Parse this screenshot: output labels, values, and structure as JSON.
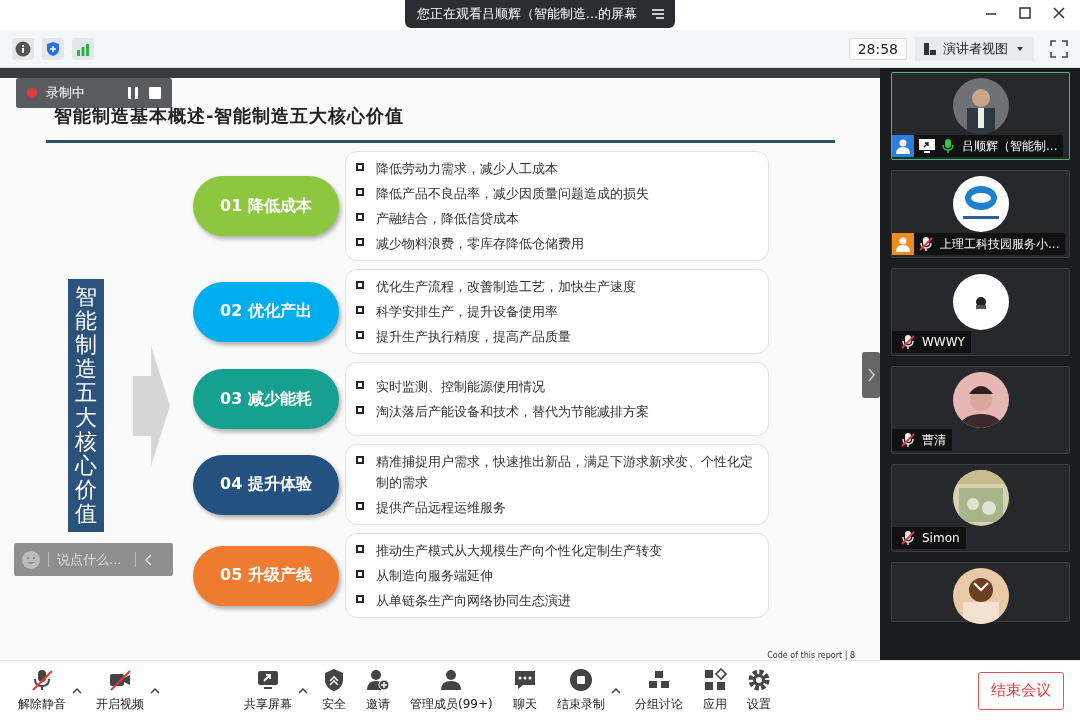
{
  "window": {
    "title": "您正在观看吕顺辉（智能制造...的屏幕"
  },
  "info_bar": {
    "timer": "28:58",
    "view_button": "演讲者视图"
  },
  "recording": {
    "label": "录制中"
  },
  "slide": {
    "title": "智能制造基本概述-智能制造五大核心价值",
    "side_label": "智能制造五大核心价值",
    "footer": "Code of this report | 8",
    "values": [
      {
        "label": "01 降低成本",
        "color": "#8dc63f",
        "points": [
          "降低劳动力需求，减少人工成本",
          "降低产品不良品率，减少因质量问题造成的损失",
          "产融结合，降低信贷成本",
          "减少物料浪费，零库存降低仓储费用"
        ]
      },
      {
        "label": "02 优化产出",
        "color": "#00aeef",
        "points": [
          "优化生产流程，改善制造工艺，加快生产速度",
          "科学安排生产，提升设备使用率",
          "提升生产执行精度，提高产品质量"
        ]
      },
      {
        "label": "03 减少能耗",
        "color": "#16a08f",
        "points": [
          "实时监测、控制能源使用情况",
          "淘汰落后产能设备和技术，替代为节能减排方案"
        ]
      },
      {
        "label": "04 提升体验",
        "color": "#24517f",
        "points": [
          "精准捕捉用户需求，快速推出新品，满足下游求新求变、个性化定制的需求",
          "提供产品远程运维服务"
        ]
      },
      {
        "label": "05 升级产线",
        "color": "#ee7b30",
        "points": [
          "推动生产模式从大规模生产向个性化定制生产转变",
          "从制造向服务端延伸",
          "从单链条生产向网络协同生态演进"
        ]
      }
    ]
  },
  "chat_box": {
    "placeholder": "说点什么..."
  },
  "participants": [
    {
      "name": "吕顺辉（智能制...",
      "kind": "host",
      "muted": false,
      "speaking": true,
      "sharing": true
    },
    {
      "name": "上理工科技园服务小...",
      "kind": "cohost",
      "muted": true,
      "speaking": false,
      "sharing": false
    },
    {
      "name": "WWWY",
      "kind": "attendee",
      "muted": true,
      "speaking": false,
      "sharing": false
    },
    {
      "name": "曹清",
      "kind": "attendee",
      "muted": true,
      "speaking": false,
      "sharing": false
    },
    {
      "name": "Simon",
      "kind": "attendee",
      "muted": true,
      "speaking": false,
      "sharing": false
    }
  ],
  "toolbar": [
    {
      "label": "解除静音",
      "kind": "mic",
      "off": true,
      "caret": true
    },
    {
      "label": "开启视频",
      "kind": "camera",
      "off": true,
      "caret": true
    },
    {
      "label": "共享屏幕",
      "kind": "share",
      "off": false,
      "caret": true
    },
    {
      "label": "安全",
      "kind": "shield",
      "off": false,
      "caret": false
    },
    {
      "label": "邀请",
      "kind": "invite",
      "off": false,
      "caret": false
    },
    {
      "label": "管理成员(99+)",
      "kind": "members",
      "off": false,
      "caret": false
    },
    {
      "label": "聊天",
      "kind": "chat",
      "off": false,
      "caret": false
    },
    {
      "label": "结束录制",
      "kind": "stop",
      "off": false,
      "caret": true
    },
    {
      "label": "分组讨论",
      "kind": "groups",
      "off": false,
      "caret": false
    },
    {
      "label": "应用",
      "kind": "apps",
      "off": false,
      "caret": false
    },
    {
      "label": "设置",
      "kind": "gear",
      "off": false,
      "caret": false
    }
  ],
  "end_button": "结束会议"
}
